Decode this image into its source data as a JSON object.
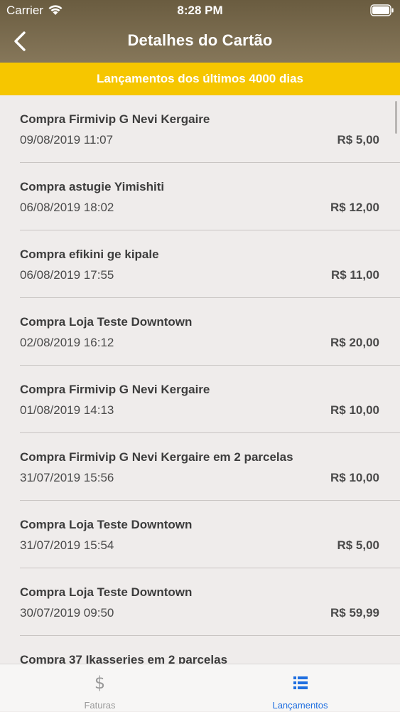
{
  "status_bar": {
    "carrier": "Carrier",
    "time": "8:28 PM"
  },
  "header": {
    "title": "Detalhes do Cartão",
    "back_icon": "chevron-left-icon"
  },
  "banner": {
    "text": "Lançamentos dos últimos 4000 dias"
  },
  "transactions": [
    {
      "description": "Compra Firmivip G Nevi Kergaire",
      "datetime": "09/08/2019 11:07",
      "amount": "R$ 5,00"
    },
    {
      "description": "Compra astugie Yimishiti",
      "datetime": "06/08/2019 18:02",
      "amount": "R$ 12,00"
    },
    {
      "description": "Compra efikini ge kipale",
      "datetime": "06/08/2019 17:55",
      "amount": "R$ 11,00"
    },
    {
      "description": "Compra Loja Teste Downtown",
      "datetime": "02/08/2019 16:12",
      "amount": "R$ 20,00"
    },
    {
      "description": "Compra Firmivip G Nevi Kergaire",
      "datetime": "01/08/2019 14:13",
      "amount": "R$ 10,00"
    },
    {
      "description": "Compra Firmivip G Nevi Kergaire em 2 parcelas",
      "datetime": "31/07/2019 15:56",
      "amount": "R$ 10,00"
    },
    {
      "description": "Compra Loja Teste Downtown",
      "datetime": "31/07/2019 15:54",
      "amount": "R$ 5,00"
    },
    {
      "description": "Compra Loja Teste Downtown",
      "datetime": "30/07/2019 09:50",
      "amount": "R$ 59,99"
    },
    {
      "description": "Compra 37 Ikasseries em 2 parcelas",
      "datetime": "",
      "amount": ""
    }
  ],
  "tab_bar": {
    "tabs": [
      {
        "label": "Faturas",
        "icon": "dollar-icon",
        "selected": false
      },
      {
        "label": "Lançamentos",
        "icon": "list-icon",
        "selected": true
      }
    ]
  },
  "colors": {
    "header": "#7a6b4e",
    "banner": "#f6c600",
    "accent": "#1f6fe0",
    "background": "#efeceb"
  }
}
